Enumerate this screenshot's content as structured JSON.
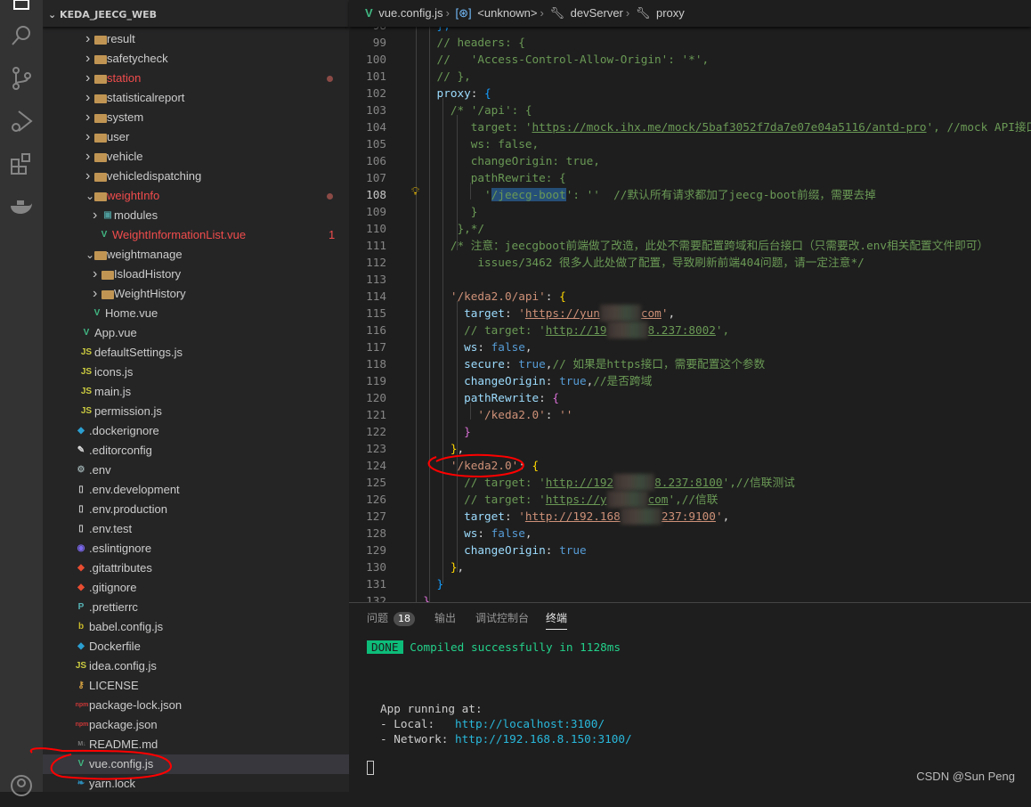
{
  "explorer": {
    "title": "KEDA_JEECG_WEB",
    "items": [
      {
        "label": "result",
        "type": "folder",
        "level": 2,
        "collapsed": true
      },
      {
        "label": "safetycheck",
        "type": "folder",
        "level": 2,
        "collapsed": true
      },
      {
        "label": "station",
        "type": "folder",
        "level": 2,
        "collapsed": true,
        "modified": true
      },
      {
        "label": "statisticalreport",
        "type": "folder",
        "level": 2,
        "collapsed": true
      },
      {
        "label": "system",
        "type": "folder",
        "level": 2,
        "collapsed": true
      },
      {
        "label": "user",
        "type": "folder",
        "level": 2,
        "collapsed": true
      },
      {
        "label": "vehicle",
        "type": "folder",
        "level": 2,
        "collapsed": true
      },
      {
        "label": "vehicledispatching",
        "type": "folder",
        "level": 2,
        "collapsed": true
      },
      {
        "label": "weightInfo",
        "type": "folder-open",
        "level": 2,
        "modified": true
      },
      {
        "label": "modules",
        "type": "modules-folder",
        "level": 3,
        "collapsed": true
      },
      {
        "label": "WeightInformationList.vue",
        "type": "vue",
        "level": 3,
        "modified": true,
        "problems": "1"
      },
      {
        "label": "weightmanage",
        "type": "folder-open",
        "level": 2
      },
      {
        "label": "IsloadHistory",
        "type": "folder",
        "level": 3,
        "collapsed": true
      },
      {
        "label": "WeightHistory",
        "type": "folder",
        "level": 3,
        "collapsed": true
      },
      {
        "label": "Home.vue",
        "type": "vue",
        "level": 2.5
      },
      {
        "label": "App.vue",
        "type": "vue",
        "level": 1.5
      },
      {
        "label": "defaultSettings.js",
        "type": "js",
        "level": 1.5
      },
      {
        "label": "icons.js",
        "type": "js",
        "level": 1.5
      },
      {
        "label": "main.js",
        "type": "js",
        "level": 1.5
      },
      {
        "label": "permission.js",
        "type": "js",
        "level": 1.5
      },
      {
        "label": ".dockerignore",
        "type": "docker",
        "level": 1
      },
      {
        "label": ".editorconfig",
        "type": "editorconfig",
        "level": 1
      },
      {
        "label": ".env",
        "type": "gear",
        "level": 1
      },
      {
        "label": ".env.development",
        "type": "file",
        "level": 1
      },
      {
        "label": ".env.production",
        "type": "file",
        "level": 1
      },
      {
        "label": ".env.test",
        "type": "file",
        "level": 1
      },
      {
        "label": ".eslintignore",
        "type": "eslint",
        "level": 1
      },
      {
        "label": ".gitattributes",
        "type": "git",
        "level": 1
      },
      {
        "label": ".gitignore",
        "type": "git",
        "level": 1
      },
      {
        "label": ".prettierrc",
        "type": "prettier",
        "level": 1
      },
      {
        "label": "babel.config.js",
        "type": "babel",
        "level": 1
      },
      {
        "label": "Dockerfile",
        "type": "docker",
        "level": 1
      },
      {
        "label": "idea.config.js",
        "type": "js",
        "level": 1
      },
      {
        "label": "LICENSE",
        "type": "license",
        "level": 1
      },
      {
        "label": "package-lock.json",
        "type": "npm",
        "level": 1
      },
      {
        "label": "package.json",
        "type": "npm",
        "level": 1
      },
      {
        "label": "README.md",
        "type": "markdown",
        "level": 1
      },
      {
        "label": "vue.config.js",
        "type": "vue-config",
        "level": 1,
        "selected": true
      },
      {
        "label": "yarn.lock",
        "type": "yarn",
        "level": 1
      }
    ]
  },
  "breadcrumb": [
    "vue.config.js",
    "<unknown>",
    "devServer",
    "proxy"
  ],
  "editor": {
    "current_line": 108,
    "lines": [
      {
        "n": 98,
        "t": [
          [
            "bb",
            "    },"
          ]
        ]
      },
      {
        "n": 99,
        "t": [
          [
            "c",
            "    // headers: {"
          ]
        ]
      },
      {
        "n": 100,
        "t": [
          [
            "c",
            "    //   'Access-Control-Allow-Origin': '*',"
          ]
        ]
      },
      {
        "n": 101,
        "t": [
          [
            "c",
            "    // },"
          ]
        ]
      },
      {
        "n": 102,
        "t": [
          [
            "k",
            "    proxy"
          ],
          [
            "p",
            ": "
          ],
          [
            "bb",
            "{"
          ]
        ]
      },
      {
        "n": 103,
        "t": [
          [
            "c",
            "      /* '/api': {"
          ]
        ]
      },
      {
        "n": 104,
        "t": [
          [
            "c",
            "         target: '"
          ],
          [
            "c u",
            "https://mock.ihx.me/mock/5baf3052f7da7e07e04a5116/antd-pro"
          ],
          [
            "c",
            "', //mock API接口"
          ]
        ]
      },
      {
        "n": 105,
        "t": [
          [
            "c",
            "         ws: false,"
          ]
        ]
      },
      {
        "n": 106,
        "t": [
          [
            "c",
            "         changeOrigin: true,"
          ]
        ]
      },
      {
        "n": 107,
        "t": [
          [
            "c",
            "         pathRewrite: {"
          ]
        ]
      },
      {
        "n": 108,
        "t": [
          [
            "c",
            "           '"
          ],
          [
            "c hl",
            "/jeecg-boot"
          ],
          [
            "c",
            "': ''  //默认所有请求都加了jeecg-boot前缀，需要去掉"
          ]
        ]
      },
      {
        "n": 109,
        "t": [
          [
            "c",
            "         }"
          ]
        ]
      },
      {
        "n": 110,
        "t": [
          [
            "c",
            "       },*/"
          ]
        ]
      },
      {
        "n": 111,
        "t": [
          [
            "c",
            "      /* 注意：jeecgboot前端做了改造，此处不需要配置跨域和后台接口（只需要改.env相关配置文件即可）"
          ]
        ]
      },
      {
        "n": 112,
        "t": [
          [
            "c",
            "          issues/3462 很多人此处做了配置，导致刷新前端404问题，请一定注意*/"
          ]
        ]
      },
      {
        "n": 113,
        "t": []
      },
      {
        "n": 114,
        "t": [
          [
            "s",
            "      '/keda2.0/api'"
          ],
          [
            "p",
            ": "
          ],
          [
            "y",
            "{"
          ]
        ]
      },
      {
        "n": 115,
        "t": [
          [
            "k",
            "        target"
          ],
          [
            "p",
            ": "
          ],
          [
            "s",
            "'"
          ],
          [
            "s u",
            "https://yun"
          ],
          [
            "blur",
            ""
          ],
          [
            "s u",
            "com"
          ],
          [
            "s",
            "'"
          ],
          [
            "p",
            ","
          ]
        ]
      },
      {
        "n": 116,
        "t": [
          [
            "c",
            "        // target: '"
          ],
          [
            "c u",
            "http://19"
          ],
          [
            "blur",
            ""
          ],
          [
            "c u",
            "8.237:8002"
          ],
          [
            "c",
            "',"
          ]
        ]
      },
      {
        "n": 117,
        "t": [
          [
            "k",
            "        ws"
          ],
          [
            "p",
            ": "
          ],
          [
            "b",
            "false"
          ],
          [
            "p",
            ","
          ]
        ]
      },
      {
        "n": 118,
        "t": [
          [
            "k",
            "        secure"
          ],
          [
            "p",
            ": "
          ],
          [
            "b",
            "true"
          ],
          [
            "p",
            ","
          ],
          [
            "c",
            "// 如果是https接口，需要配置这个参数"
          ]
        ]
      },
      {
        "n": 119,
        "t": [
          [
            "k",
            "        changeOrigin"
          ],
          [
            "p",
            ": "
          ],
          [
            "b",
            "true"
          ],
          [
            "p",
            ","
          ],
          [
            "c",
            "//是否跨域"
          ]
        ]
      },
      {
        "n": 120,
        "t": [
          [
            "k",
            "        pathRewrite"
          ],
          [
            "p",
            ": "
          ],
          [
            "m",
            "{"
          ]
        ]
      },
      {
        "n": 121,
        "t": [
          [
            "s",
            "          '/keda2.0'"
          ],
          [
            "p",
            ": "
          ],
          [
            "s",
            "''"
          ]
        ]
      },
      {
        "n": 122,
        "t": [
          [
            "m",
            "        }"
          ]
        ]
      },
      {
        "n": 123,
        "t": [
          [
            "y",
            "      }"
          ],
          [
            "p",
            ","
          ]
        ]
      },
      {
        "n": 124,
        "t": [
          [
            "s",
            "      '/keda2.0'"
          ],
          [
            "p",
            ": "
          ],
          [
            "y",
            "{"
          ]
        ]
      },
      {
        "n": 125,
        "t": [
          [
            "c",
            "        // target: '"
          ],
          [
            "c u",
            "http://192"
          ],
          [
            "blur",
            ""
          ],
          [
            "c u",
            "8.237:8100"
          ],
          [
            "c",
            "',//信联测试"
          ]
        ]
      },
      {
        "n": 126,
        "t": [
          [
            "c",
            "        // target: '"
          ],
          [
            "c u",
            "https://y"
          ],
          [
            "blur",
            ""
          ],
          [
            "c u",
            "com"
          ],
          [
            "c",
            "',//信联"
          ]
        ]
      },
      {
        "n": 127,
        "t": [
          [
            "k",
            "        target"
          ],
          [
            "p",
            ": "
          ],
          [
            "s",
            "'"
          ],
          [
            "s u",
            "http://192.168"
          ],
          [
            "blur",
            ""
          ],
          [
            "s u",
            "237:9100"
          ],
          [
            "s",
            "'"
          ],
          [
            "p",
            ","
          ]
        ]
      },
      {
        "n": 128,
        "t": [
          [
            "k",
            "        ws"
          ],
          [
            "p",
            ": "
          ],
          [
            "b",
            "false"
          ],
          [
            "p",
            ","
          ]
        ]
      },
      {
        "n": 129,
        "t": [
          [
            "k",
            "        changeOrigin"
          ],
          [
            "p",
            ": "
          ],
          [
            "b",
            "true"
          ]
        ]
      },
      {
        "n": 130,
        "t": [
          [
            "y",
            "      }"
          ],
          [
            "p",
            ","
          ]
        ]
      },
      {
        "n": 131,
        "t": [
          [
            "bb",
            "    }"
          ]
        ]
      },
      {
        "n": 132,
        "t": [
          [
            "m",
            "  }"
          ]
        ]
      }
    ]
  },
  "panel": {
    "tabs": [
      {
        "label": "问题",
        "badge": "18"
      },
      {
        "label": "输出"
      },
      {
        "label": "调试控制台"
      },
      {
        "label": "终端",
        "active": true
      }
    ],
    "terminal": {
      "done_label": "DONE",
      "compiled": "Compiled successfully in 1128ms",
      "running": "App running at:",
      "local_label": "- Local:   ",
      "local_url": "http://localhost:3100/",
      "network_label": "- Network: ",
      "network_url": "http://192.168.8.150:3100/"
    }
  },
  "watermark": "CSDN @Sun  Peng",
  "colors": {
    "accent": "#0dbc79",
    "modified": "#f14c4c",
    "selection": "#264f78",
    "annotation": "#ff0000"
  }
}
